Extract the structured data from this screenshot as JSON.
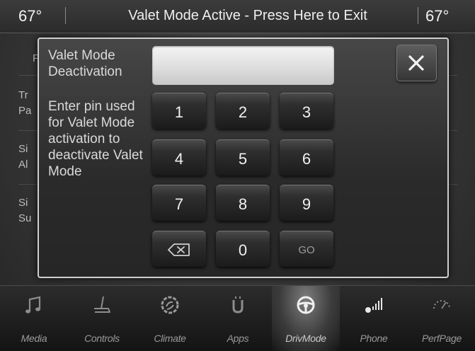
{
  "status_bar": {
    "temp_left": "67°",
    "temp_right": "67°",
    "valet_banner": "Valet Mode Active - Press Here to Exit"
  },
  "background_menu": {
    "fragments": [
      "F",
      "Tr",
      "Pa",
      "Si",
      "Al",
      "Si",
      "Su"
    ]
  },
  "dialog": {
    "title": "Valet Mode Deactivation",
    "instructions": "Enter pin used for Valet Mode activation to deactivate Valet Mode",
    "pin_value": "",
    "close_icon": "close-icon",
    "keypad": {
      "k1": "1",
      "k2": "2",
      "k3": "3",
      "k4": "4",
      "k5": "5",
      "k6": "6",
      "k7": "7",
      "k8": "8",
      "k9": "9",
      "backspace_icon": "backspace-icon",
      "k0": "0",
      "go": "GO"
    }
  },
  "nav": {
    "items": [
      {
        "label": "Media",
        "icon": "music-note-icon"
      },
      {
        "label": "Controls",
        "icon": "seat-icon"
      },
      {
        "label": "Climate",
        "icon": "climate-icon"
      },
      {
        "label": "Apps",
        "icon": "apps-icon"
      },
      {
        "label": "DrivMode",
        "icon": "steering-wheel-icon",
        "active": true
      },
      {
        "label": "Phone",
        "icon": "phone-signal-icon"
      },
      {
        "label": "PerfPage",
        "icon": "gauge-icon"
      }
    ]
  }
}
